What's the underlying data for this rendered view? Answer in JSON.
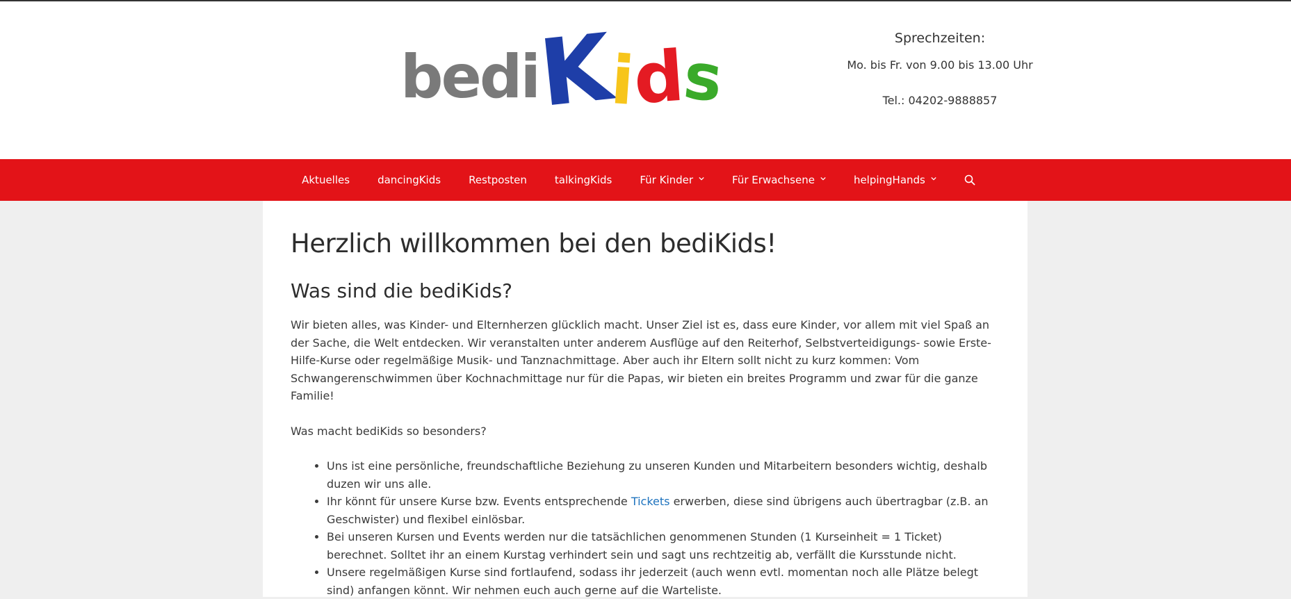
{
  "header": {
    "logo": {
      "part1": "bedi",
      "part2": [
        "K",
        "i",
        "d",
        "s"
      ],
      "colors": [
        "#1e3ea8",
        "#f7c51b",
        "#e41b23",
        "#3aaa2a"
      ]
    },
    "contact": {
      "title": "Sprechzeiten:",
      "hours": "Mo. bis Fr. von 9.00 bis 13.00 Uhr",
      "phone": "Tel.: 04202-9888857"
    }
  },
  "nav": {
    "background": "#e31318",
    "items": [
      {
        "label": "Aktuelles",
        "dropdown": false
      },
      {
        "label": "dancingKids",
        "dropdown": false
      },
      {
        "label": "Restposten",
        "dropdown": false
      },
      {
        "label": "talkingKids",
        "dropdown": false
      },
      {
        "label": "Für Kinder",
        "dropdown": true
      },
      {
        "label": "Für Erwachsene",
        "dropdown": true
      },
      {
        "label": "helpingHands",
        "dropdown": true
      }
    ],
    "search_icon": "search-icon"
  },
  "main": {
    "title": "Herzlich willkommen bei den bediKids!",
    "subtitle": "Was sind die bediKids?",
    "intro": "Wir bieten alles, was Kinder- und Elternherzen glücklich macht. Unser Ziel ist es, dass eure Kinder, vor allem mit viel Spaß an der Sache, die Welt entdecken. Wir veranstalten unter anderem Ausflüge auf den Reiterhof, Selbstverteidigungs- sowie Erste-Hilfe-Kurse oder regelmäßige Musik- und Tanznachmittage. Aber auch ihr Eltern sollt nicht zu kurz kommen: Vom Schwangerenschwimmen über Kochnachmittage nur für die Papas, wir bieten ein breites Programm und zwar für die ganze Familie!",
    "question": "Was macht bediKids so besonders?",
    "bullets": [
      {
        "text": "Uns ist eine persönliche, freundschaftliche Beziehung zu unseren Kunden und Mitarbeitern besonders wichtig, deshalb duzen wir uns alle."
      },
      {
        "before": "Ihr könnt für unsere Kurse bzw. Events entsprechende ",
        "link": "Tickets",
        "after": " erwerben, diese sind übrigens auch übertragbar (z.B. an Geschwister) und flexibel einlösbar."
      },
      {
        "text": "Bei unseren Kursen und Events werden nur die tatsächlichen genommenen Stunden (1 Kurseinheit = 1 Ticket) berechnet. Solltet ihr an einem Kurstag verhindert sein und sagt uns rechtzeitig ab, verfällt die Kursstunde nicht."
      },
      {
        "text": "Unsere regelmäßigen Kurse sind fortlaufend, sodass ihr jederzeit (auch wenn evtl. momentan noch alle Plätze belegt sind) anfangen könnt. Wir nehmen euch auch gerne auf die Warteliste."
      }
    ]
  }
}
